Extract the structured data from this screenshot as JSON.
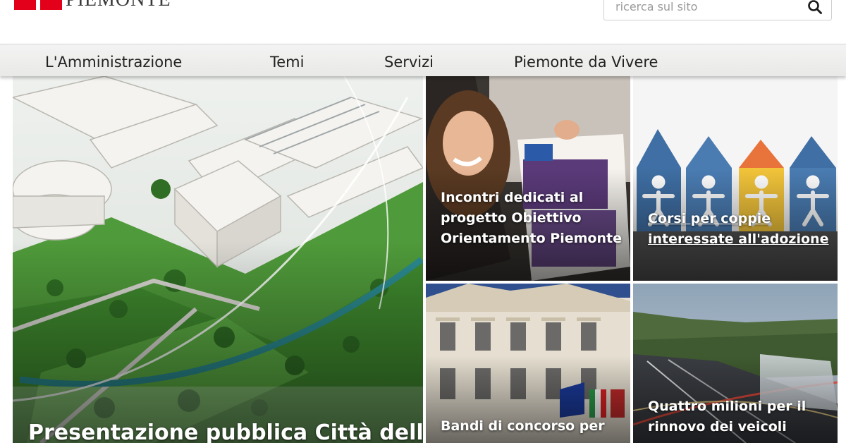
{
  "header": {
    "logo_text": "PIEMONTE",
    "search": {
      "placeholder": "ricerca sul sito"
    }
  },
  "nav": {
    "items": [
      "L'Amministrazione",
      "Temi",
      "Servizi",
      "Piemonte da Vivere"
    ]
  },
  "tiles": {
    "hero": {
      "caption": "Presentazione pubblica Città della"
    },
    "t1": {
      "caption": "Incontri dedicati al progetto Obiettivo Orientamento Piemonte"
    },
    "t2": {
      "caption": "Corsi per coppie interessate all'adozione"
    },
    "t3": {
      "caption": "Bandi di concorso per"
    },
    "t4": {
      "caption": "Quattro milioni per il rinnovo dei veicoli"
    }
  },
  "colors": {
    "brand_red": "#e2001a",
    "nav_bg": "#efefee"
  },
  "icons": {
    "search": "search-icon"
  }
}
